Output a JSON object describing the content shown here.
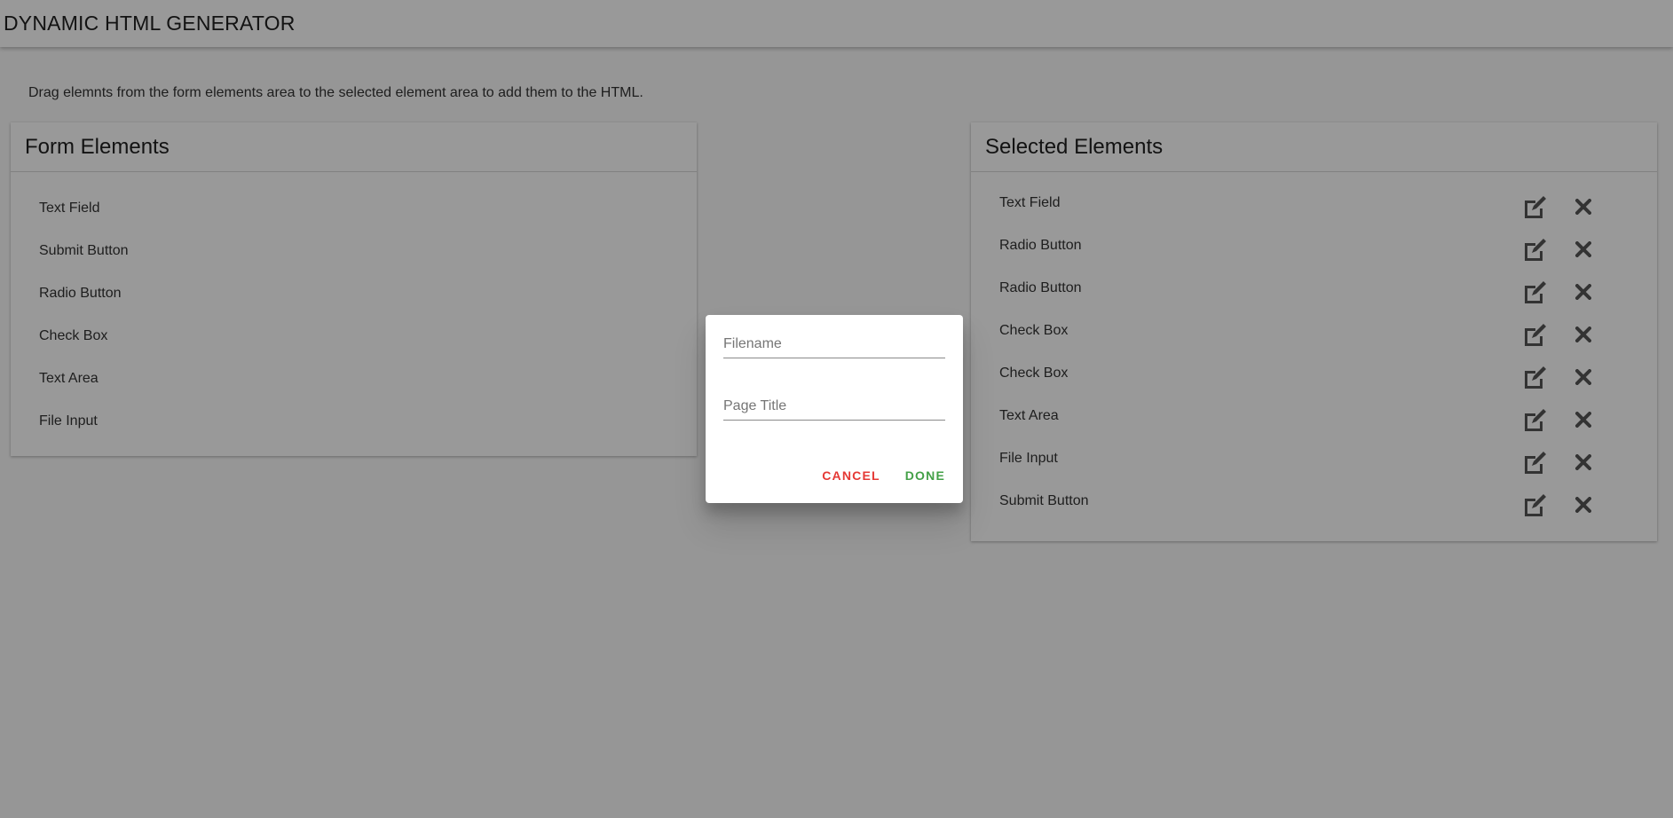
{
  "app": {
    "title": "DYNAMIC HTML GENERATOR"
  },
  "instructions": "Drag elemnts from the form elements area to the selected element area to add them to the HTML.",
  "form_elements": {
    "title": "Form Elements",
    "items": [
      "Text Field",
      "Submit Button",
      "Radio Button",
      "Check Box",
      "Text Area",
      "File Input"
    ]
  },
  "selected_elements": {
    "title": "Selected Elements",
    "items": [
      "Text Field",
      "Radio Button",
      "Radio Button",
      "Check Box",
      "Check Box",
      "Text Area",
      "File Input",
      "Submit Button"
    ],
    "edit_icon": "edit-icon",
    "delete_icon": "close-icon"
  },
  "dialog": {
    "filename_placeholder": "Filename",
    "filename_value": "",
    "page_title_placeholder": "Page Title",
    "page_title_value": "",
    "cancel_label": "CANCEL",
    "done_label": "DONE"
  },
  "colors": {
    "cancel": "#e53935",
    "done": "#43a047",
    "overlay": "rgba(0,0,0,0.4)"
  }
}
